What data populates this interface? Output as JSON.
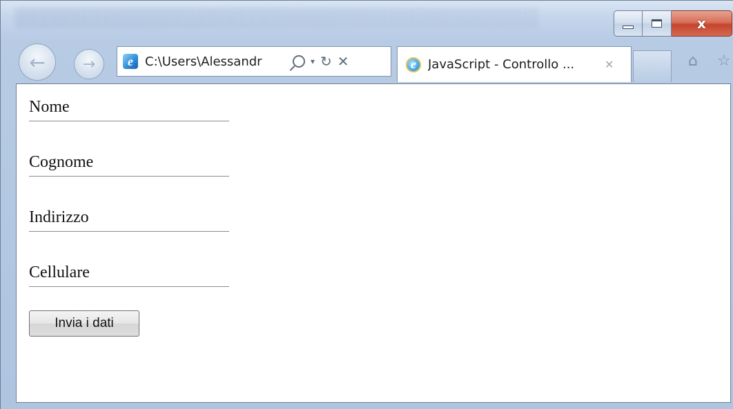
{
  "window": {
    "caption_minimize_icon": "minimize-icon",
    "caption_maximize_icon": "maximize-icon",
    "caption_close_glyph": "x"
  },
  "nav": {
    "back_icon": "back-arrow-icon",
    "forward_icon": "forward-arrow-icon"
  },
  "address_bar": {
    "url": "C:\\Users\\Alessandr",
    "site_icon": "ie-page-icon",
    "tools": [
      "search-icon",
      "dropdown-icon",
      "refresh-icon",
      "stop-icon"
    ]
  },
  "tab": {
    "title": "JavaScript - Controllo ...",
    "icon": "ie-logo-icon",
    "close_icon": "close-icon"
  },
  "toolbar_right": {
    "home_icon": "home-icon",
    "favorites_icon": "favorites-star-icon"
  },
  "form": {
    "fields": [
      {
        "label": "Nome",
        "value": ""
      },
      {
        "label": "Cognome",
        "value": ""
      },
      {
        "label": "Indirizzo",
        "value": ""
      },
      {
        "label": "Cellulare",
        "value": ""
      }
    ],
    "submit_label": "Invia i dati"
  },
  "colors": {
    "frame": "#b7cbe4",
    "close_button": "#c7442c",
    "content_bg": "#ffffff"
  }
}
